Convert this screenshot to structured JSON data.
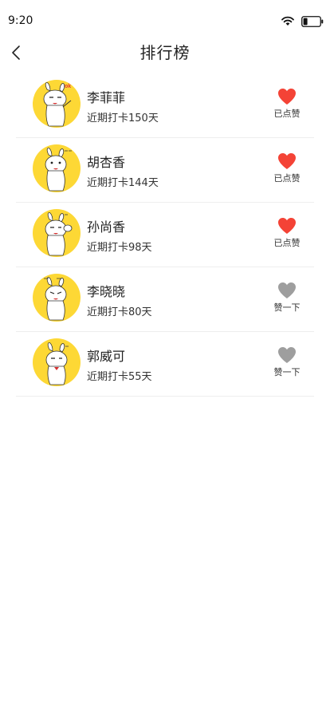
{
  "status_bar": {
    "time": "9:20"
  },
  "nav": {
    "title": "排行榜"
  },
  "colors": {
    "liked": "#f44336",
    "unliked": "#9e9e9e",
    "avatar_bg": "#fdd835"
  },
  "items": [
    {
      "name": "李菲菲",
      "checkin": "近期打卡150天",
      "liked": true,
      "like_label": "已点赞",
      "avatar_badge": "ok"
    },
    {
      "name": "胡杏香",
      "checkin": "近期打卡144天",
      "liked": true,
      "like_label": "已点赞",
      "avatar_badge": ""
    },
    {
      "name": "孙尚香",
      "checkin": "近期打卡98天",
      "liked": true,
      "like_label": "已点赞",
      "avatar_badge": ""
    },
    {
      "name": "李晓晓",
      "checkin": "近期打卡80天",
      "liked": false,
      "like_label": "赞一下",
      "avatar_badge": ""
    },
    {
      "name": "郭威可",
      "checkin": "近期打卡55天",
      "liked": false,
      "like_label": "赞一下",
      "avatar_badge": ""
    }
  ]
}
